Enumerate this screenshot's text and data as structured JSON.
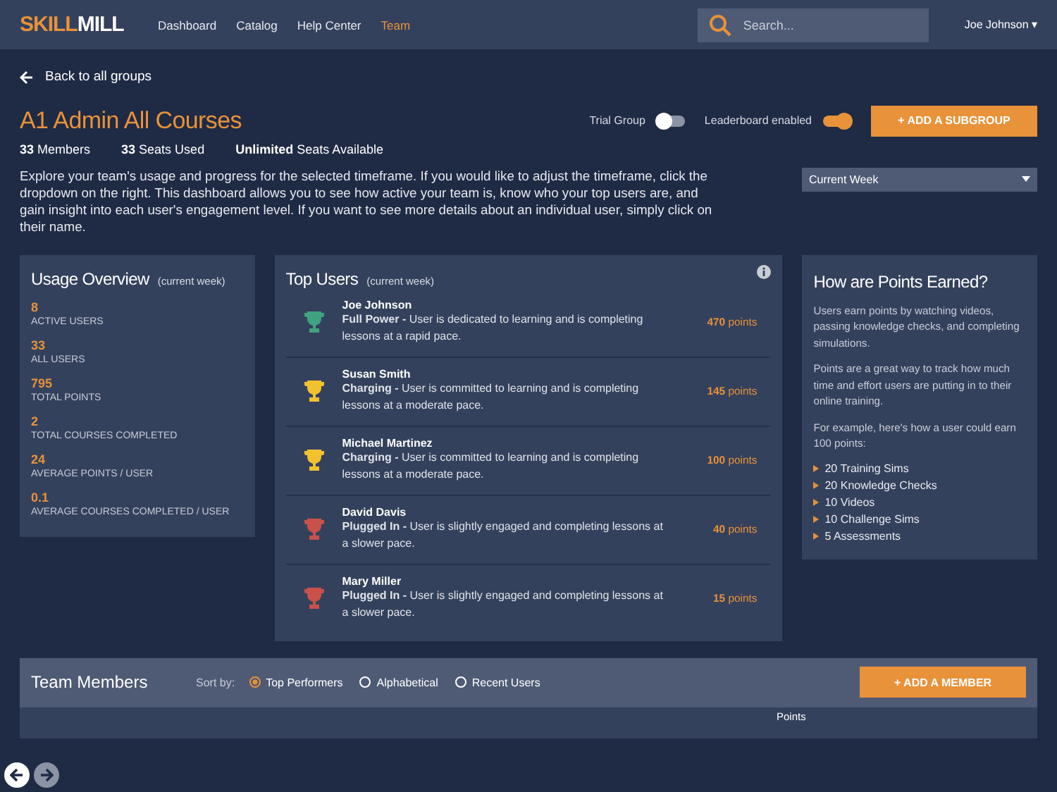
{
  "nav": {
    "logo_a": "SKILL",
    "logo_b": "MILL",
    "links": [
      {
        "label": "Dashboard",
        "selected": false
      },
      {
        "label": "Catalog",
        "selected": false
      },
      {
        "label": "Help Center",
        "selected": false
      },
      {
        "label": "Team",
        "selected": true
      }
    ],
    "search": {
      "placeholder": "Search..."
    },
    "user": "Joe Johnson ▾"
  },
  "back_link": "Back to all groups",
  "group": {
    "title": "A1 Admin All Courses",
    "toggles": [
      {
        "label": "Trial Group",
        "on": false
      },
      {
        "label": "Leaderboard enabled",
        "on": true
      }
    ],
    "add_button": "+ ADD A SUBGROUP",
    "stats": [
      {
        "value": "33",
        "label": "Members"
      },
      {
        "value": "33",
        "label": "Seats Used"
      },
      {
        "value": "Unlimited",
        "label": "Seats Available"
      }
    ],
    "description": "Explore your team's usage and progress for the selected timeframe. If you would like to adjust the timeframe, click the dropdown on the right. This dashboard allows you to see how active your team is, know who your top users are, and gain insight into each user's engagement level. If you want to see more details about an individual user, simply click on their name.",
    "timeframe": "Current Week"
  },
  "usage": {
    "title": "Usage Overview",
    "subtitle": "(current week)",
    "metrics": [
      {
        "value": "8",
        "label": "ACTIVE USERS"
      },
      {
        "value": "33",
        "label": "ALL USERS"
      },
      {
        "value": "795",
        "label": "TOTAL POINTS"
      },
      {
        "value": "2",
        "label": "TOTAL COURSES COMPLETED"
      },
      {
        "value": "24",
        "label": "AVERAGE POINTS / USER"
      },
      {
        "value": "0.1",
        "label": "AVERAGE COURSES COMPLETED / USER"
      }
    ]
  },
  "top_users": {
    "title": "Top Users",
    "subtitle": "(current week)",
    "users": [
      {
        "name": "Joe Johnson",
        "level": "Full Power -",
        "description": "User is dedicated to learning and is completing lessons at a rapid pace.",
        "points": "470",
        "unit": "points",
        "color": "#3fa37f"
      },
      {
        "name": "Susan Smith",
        "level": "Charging -",
        "description": "User is committed to learning and is completing lessons at a moderate pace.",
        "points": "145",
        "unit": "points",
        "color": "#f2c12e"
      },
      {
        "name": "Michael Martinez",
        "level": "Charging -",
        "description": "User is committed to learning and is completing lessons at a moderate pace.",
        "points": "100",
        "unit": "points",
        "color": "#f2c12e"
      },
      {
        "name": "David Davis",
        "level": "Plugged In -",
        "description": "User is slightly engaged and completing lessons at a slower pace.",
        "points": "40",
        "unit": "points",
        "color": "#c9514a"
      },
      {
        "name": "Mary Miller",
        "level": "Plugged In -",
        "description": "User is slightly engaged and completing lessons at a slower pace.",
        "points": "15",
        "unit": "points",
        "color": "#c9514a"
      }
    ]
  },
  "points_info": {
    "title": "How are Points Earned?",
    "paragraphs": [
      "Users earn points by watching videos, passing knowledge checks, and completing simulations.",
      "Points are a great way to track how much time and effort users are putting in to their online training.",
      "For example, here's how a user could earn 100 points:"
    ],
    "items": [
      "20 Training Sims",
      "20 Knowledge Checks",
      "10 Videos",
      "10 Challenge Sims",
      "5 Assessments"
    ]
  },
  "team_members": {
    "title": "Team Members",
    "sort_label": "Sort by:",
    "sort_options": [
      {
        "label": "Top Performers",
        "selected": true
      },
      {
        "label": "Alphabetical",
        "selected": false
      },
      {
        "label": "Recent Users",
        "selected": false
      }
    ],
    "add_button": "+ ADD A MEMBER",
    "columns": [
      "Points"
    ]
  },
  "browser_nav": {
    "back_enabled": true,
    "forward_enabled": false
  }
}
